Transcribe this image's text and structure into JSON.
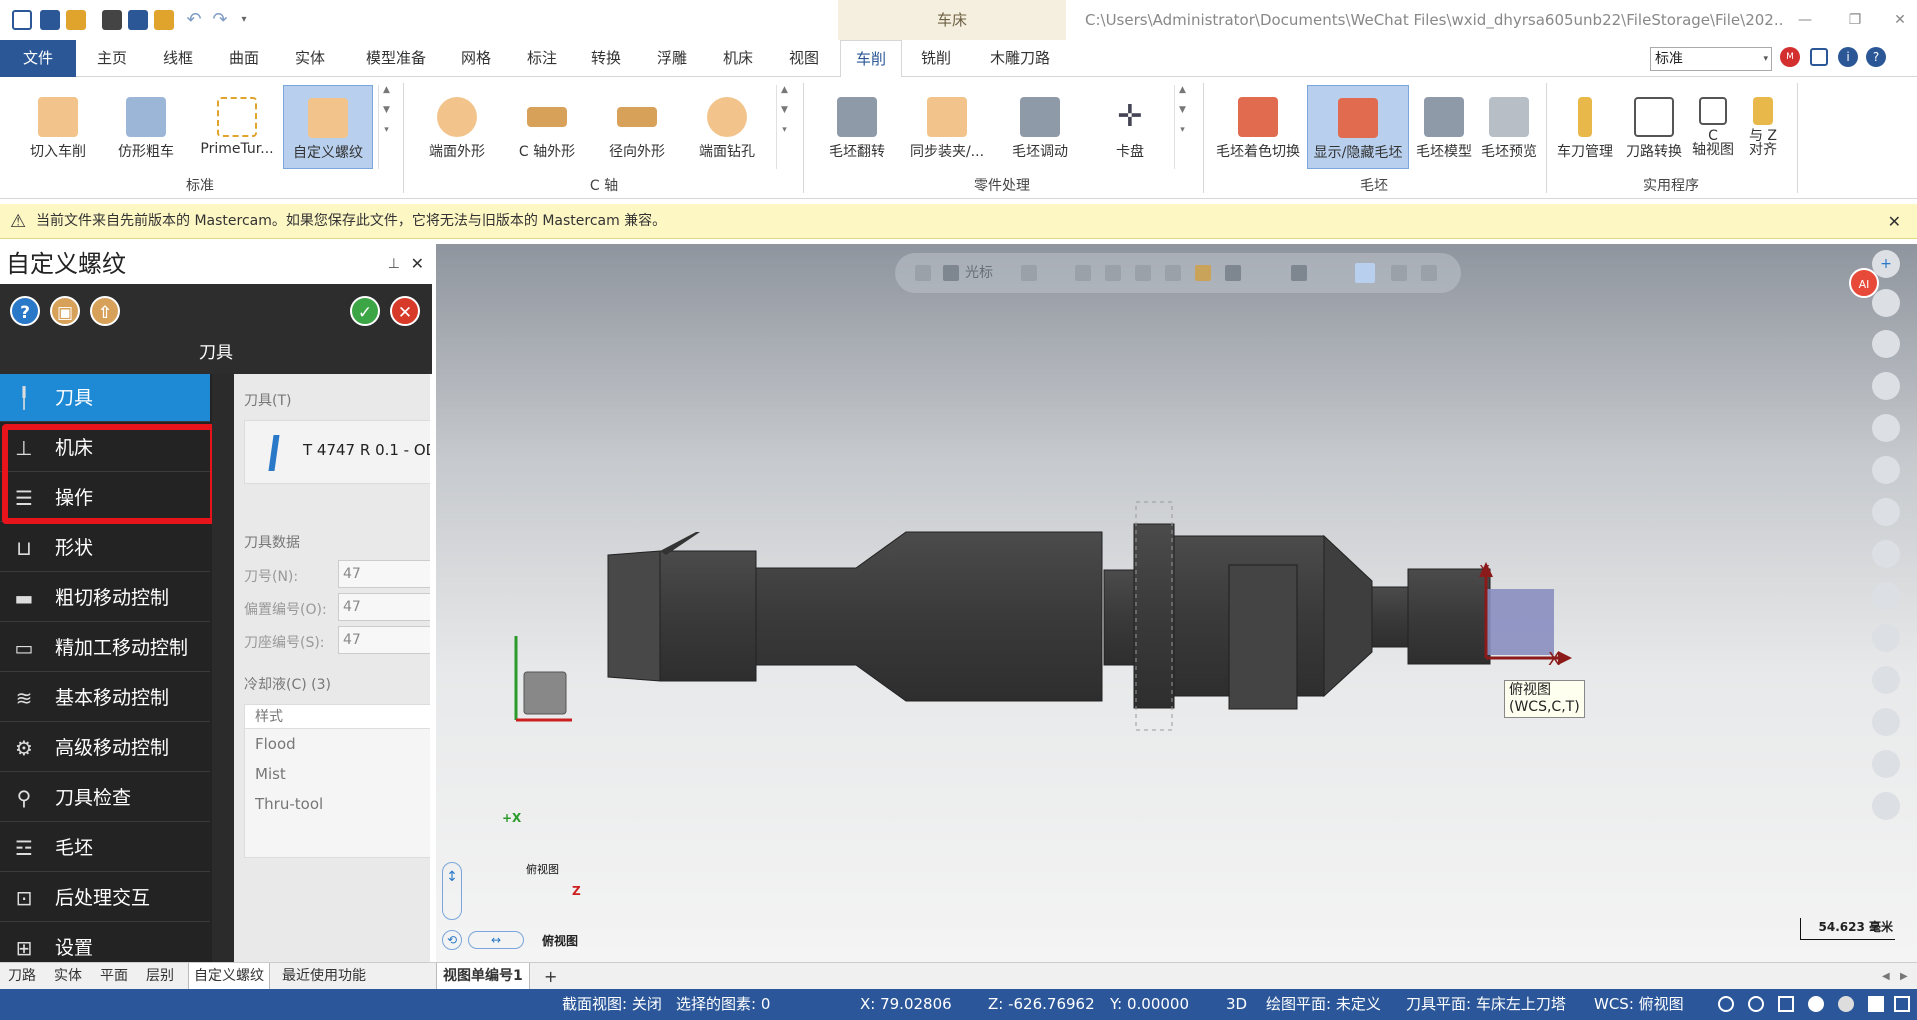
{
  "window": {
    "context_tab": "车床",
    "path": "C:\\Users\\Administrator\\Documents\\WeChat Files\\wxid_dhyrsa605unb22\\FileStorage\\File\\202..."
  },
  "tabs": [
    "文件",
    "主页",
    "线框",
    "曲面",
    "实体",
    "模型准备",
    "网格",
    "标注",
    "转换",
    "浮雕",
    "机床",
    "视图",
    "车削",
    "铣削",
    "木雕刀路"
  ],
  "active_tab": "车削",
  "style_select": "标准",
  "ribbon": {
    "groups": [
      {
        "label": "标准",
        "buttons": [
          "切入车削",
          "仿形粗车",
          "PrimeTur...",
          "自定义螺纹"
        ]
      },
      {
        "label": "C 轴",
        "buttons": [
          "端面外形",
          "C 轴外形",
          "径向外形",
          "端面钻孔"
        ]
      },
      {
        "label": "零件处理",
        "buttons": [
          "毛坯翻转",
          "同步装夹/...",
          "毛坯调动",
          "卡盘"
        ]
      },
      {
        "label": "毛坯",
        "buttons": [
          "毛坯着色切换",
          "显示/隐藏毛坯",
          "毛坯模型",
          "毛坯预览"
        ]
      },
      {
        "label": "实用程序",
        "buttons": [
          "车刀管理",
          "刀路转换",
          "C 轴视图",
          "与 Z 对齐"
        ]
      }
    ],
    "utility_labels": {
      "c_axis": [
        "C",
        "轴视图"
      ],
      "align_z": [
        "与 Z",
        "对齐"
      ]
    }
  },
  "warning": "当前文件来自先前版本的 Mastercam。如果您保存此文件，它将无法与旧版本的 Mastercam 兼容。",
  "panel": {
    "title": "自定义螺纹",
    "subtitle": "刀具",
    "nav": [
      "刀具",
      "机床",
      "操作",
      "形状",
      "粗切移动控制",
      "精加工移动控制",
      "基本移动控制",
      "高级移动控制",
      "刀具检查",
      "毛坯",
      "后处理交互",
      "设置"
    ],
    "tool_section": "刀具(T)",
    "tool_name": "T 4747 R 0.1 - OD",
    "tool_data_section": "刀具数据",
    "fields": [
      {
        "label": "刀号(N):",
        "value": "47"
      },
      {
        "label": "偏置编号(O):",
        "value": "47"
      },
      {
        "label": "刀座编号(S):",
        "value": "47"
      }
    ],
    "coolant_section": "冷却液(C) (3)",
    "coolant_header": "样式",
    "coolant_items": [
      "Flood",
      "Mist",
      "Thru-tool"
    ]
  },
  "viewport": {
    "toolbar_label": "光标",
    "view_name": "俯视图",
    "view_tip": [
      "俯视图",
      "(WCS,C,T)"
    ],
    "axis_x": "X",
    "axis_y": "Y",
    "triad_x": "+X",
    "triad_z": "Z",
    "cube_label": "俯视图",
    "scale": "54.623 毫米",
    "ai_badge": "AI"
  },
  "bottom_tabs": [
    "刀路",
    "实体",
    "平面",
    "层别",
    "自定义螺纹",
    "最近使用功能"
  ],
  "view_sheet": "视图单编号1",
  "status": {
    "section_view": "截面视图: 关闭",
    "selected": "选择的图素: 0",
    "x": "X:   79.02806",
    "z": "Z:   -626.76962",
    "y": "Y:   0.00000",
    "mode": "3D",
    "cplane": "绘图平面: 未定义",
    "tplane": "刀具平面: 车床左上刀塔",
    "wcs": "WCS: 俯视图"
  },
  "colors": {
    "accent": "#2b5797",
    "nav_active": "#1e8ad6",
    "warning_bg": "#fdf7c4",
    "highlight": "#e8141c"
  }
}
